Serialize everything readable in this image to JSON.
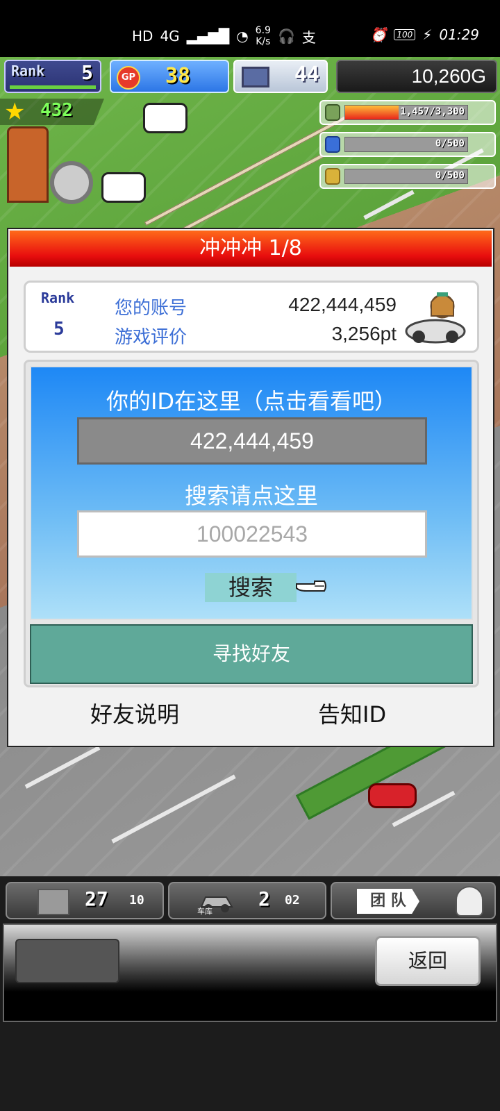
{
  "status_bar": {
    "hd": "HD",
    "network": "4G",
    "speed_value": "6.9",
    "speed_unit": "K/s",
    "alipay_glyph": "支",
    "battery": "100",
    "time": "01:29"
  },
  "hud": {
    "rank_label": "Rank",
    "rank_value": "5",
    "gp_label": "GP",
    "gp_value": "38",
    "pc_value": "44",
    "money": "10,260G",
    "star_value": "432",
    "resources": [
      {
        "name": "fuel",
        "icon": "oil-barrel-icon",
        "text": "1,457/3,300",
        "fill": 0.44,
        "color": "#7aa25a"
      },
      {
        "name": "water",
        "icon": "bottle-icon",
        "text": "0/500",
        "fill": 0,
        "color": "#3a6fd8"
      },
      {
        "name": "wheat",
        "icon": "wheat-icon",
        "text": "0/500",
        "fill": 0,
        "color": "#d9b23a"
      }
    ]
  },
  "dialog": {
    "title": "冲冲冲 1/8",
    "rank_label": "Rank",
    "rank_value": "5",
    "account_label": "您的账号",
    "account_value": "422,444,459",
    "rating_label": "游戏评价",
    "rating_value": "3,256pt",
    "id_heading": "你的ID在这里（点击看看吧）",
    "id_value": "422,444,459",
    "search_heading": "搜索请点这里",
    "search_placeholder": "100022543",
    "search_button": "搜索",
    "find_friends": "寻找好友",
    "friend_help": "好友说明",
    "tell_id": "告知ID"
  },
  "bottom": {
    "storage_count": "27",
    "storage_max": "10",
    "garage_label": "车库",
    "garage_count": "2",
    "garage_max": "02",
    "team_label": "团 队",
    "back": "返回"
  }
}
